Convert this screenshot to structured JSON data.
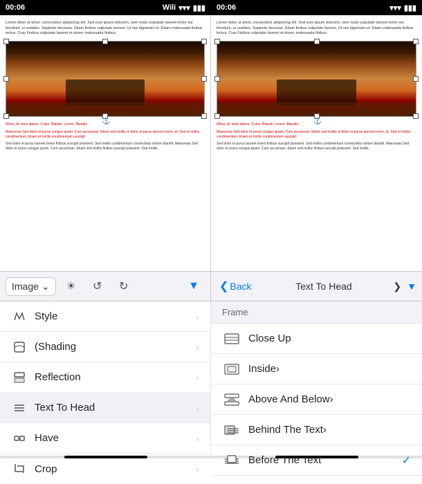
{
  "statusBars": [
    {
      "time": "00:06",
      "carrier": "Wili",
      "wifi": "📶",
      "battery": "🔋"
    },
    {
      "time": "00:06",
      "carrier": "",
      "wifi": "📶",
      "battery": "🔋"
    }
  ],
  "toolbar": {
    "imageLabel": "Image",
    "lightbulbIcon": "💡",
    "undoIcon": "↺",
    "redoIcon": "↻",
    "dropdownIcon": "▼",
    "backLabel": "Back",
    "menuTitle": "Text To Head",
    "fwdChevron": "❯"
  },
  "leftPanel": {
    "items": [
      {
        "id": "style",
        "icon": "✏️",
        "label": "Style",
        "hasChevron": true
      },
      {
        "id": "shading",
        "icon": "🖥",
        "label": "(Shading",
        "hasChevron": true
      },
      {
        "id": "reflection",
        "icon": "🖥",
        "label": "Reflection",
        "hasChevron": true
      },
      {
        "id": "text-to-head",
        "icon": "≡",
        "label": "Text To Head",
        "hasChevron": true,
        "active": true
      },
      {
        "id": "have",
        "icon": "◈",
        "label": "Have",
        "hasChevron": true
      },
      {
        "id": "crop",
        "icon": "⊢",
        "label": "Crop",
        "hasChevron": true
      }
    ]
  },
  "rightPanel": {
    "sectionHeader": "Frame",
    "items": [
      {
        "id": "close-up",
        "icon": "▤",
        "label": "Close Up",
        "hasCheck": false
      },
      {
        "id": "inside",
        "icon": "▤",
        "label": "Inside›",
        "hasCheck": false
      },
      {
        "id": "above-and-below",
        "icon": "▤",
        "label": "Above And Below›",
        "hasCheck": false
      },
      {
        "id": "behind-the-text",
        "icon": "▤",
        "label": "Behind The Text›",
        "hasCheck": false
      },
      {
        "id": "before-the-text",
        "icon": "▤",
        "label": "Before The Text",
        "hasCheck": true
      }
    ]
  },
  "docText": {
    "top": "Lorem dolor ut amet, consectetur adipiscing elit. Sed eum ipsum dolorem, sem noda vulputate laoreet tortor est tincidunt, ur sodales. Sapiente decease. Etiam finibus vulputate laoreet. Ut nisi dignissim et. Etiam malesuada finibus lectus. Cras Finibus vulputate laoreet et donec malesuada finibus.",
    "caption": "Whos, Ar intus labore. Colun. Blandn. Lorem. Blandin.",
    "body1": "Maecenas Sed dolor et purus congue quam. Cum accumsan. Etiam sed mollis et dolor et purus laoreet lorem, et. Sed et mollis condimentum. Etiam et mollis condimentum suscipit.",
    "body2": "Sed dolor et purus laoreet lorem finibus suscipit praesent. Sed mollis condimentum consectetur dolore blandit. Maecenas Sed dolor et purus congue quam. Cum accumsan. Etiam sed mollis finibus suscipit praesent. Sed mollis."
  }
}
